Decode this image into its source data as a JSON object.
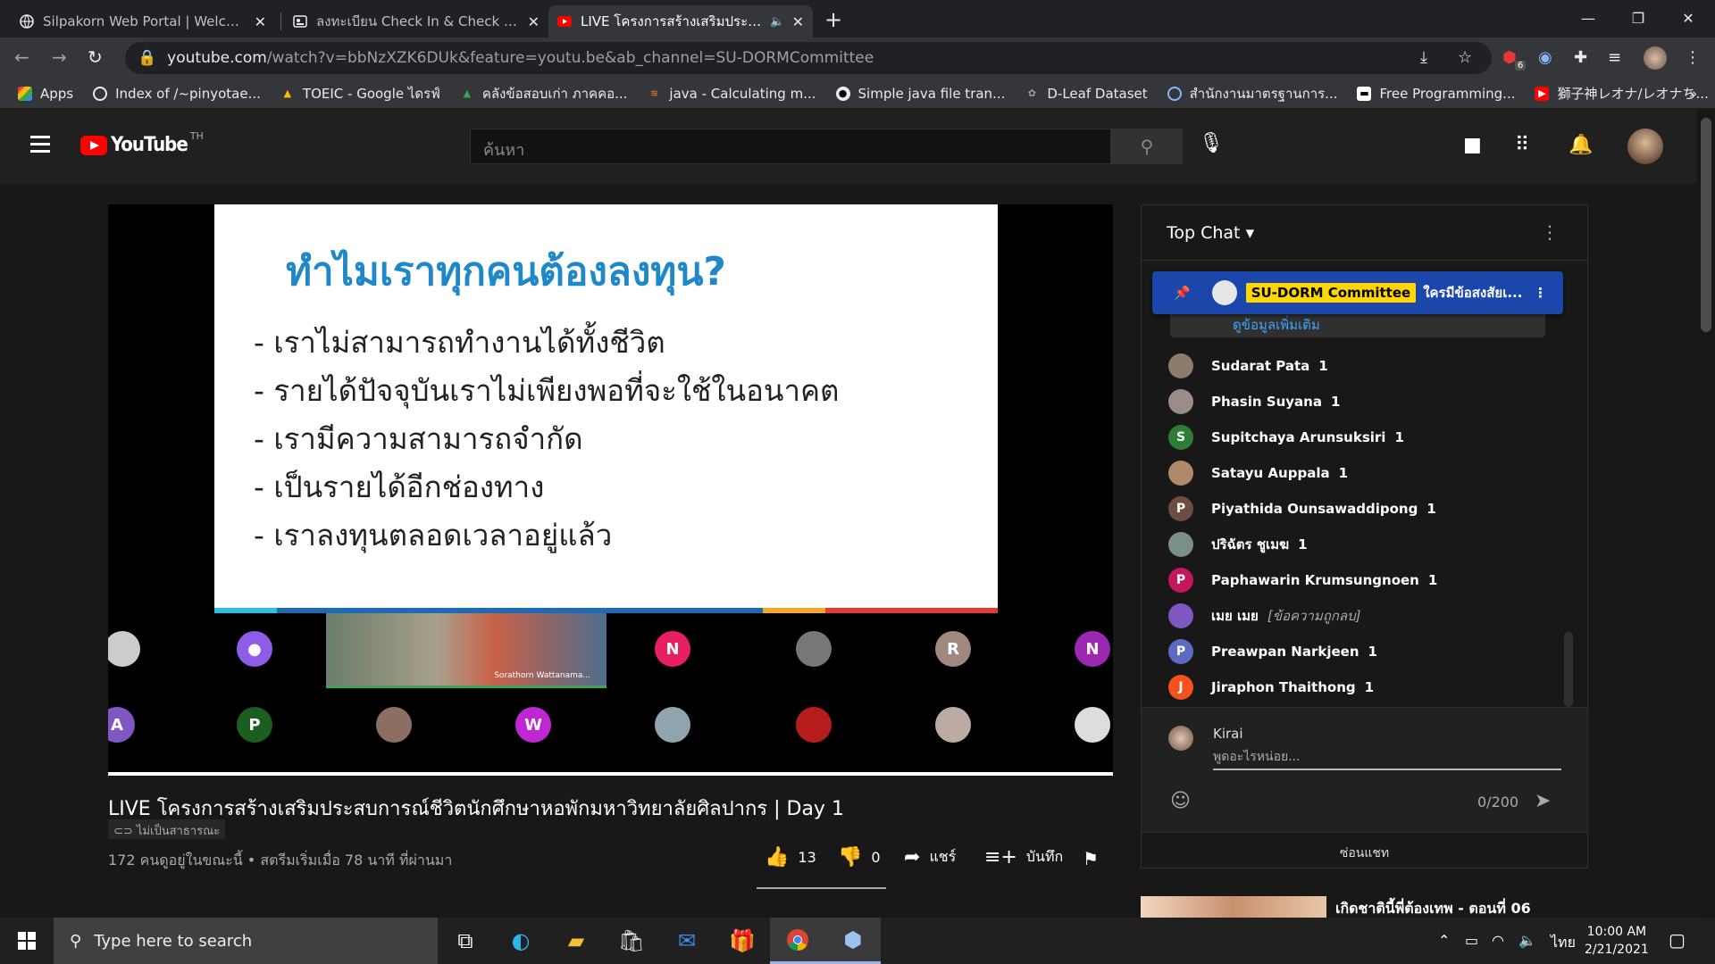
{
  "browser": {
    "tabs": [
      {
        "title": "Silpakorn Web Portal | Welcome"
      },
      {
        "title": "ลงทะเบียน Check In & Check Out ม"
      },
      {
        "title": "LIVE โครงการสร้างเสริมประสบกา"
      }
    ],
    "url_host": "youtube.com",
    "url_rest": "/watch?v=bbNzXZK6DUk&feature=youtu.be&ab_channel=SU-DORMCommittee",
    "extension_badge": "6",
    "bookmarks": [
      "Apps",
      "Index of /~pinyotae...",
      "TOEIC - Google ไดรฟ์",
      "คลังข้อสอบเก่า ภาคคอ...",
      "java - Calculating m...",
      "Simple java file tran...",
      "D-Leaf Dataset",
      "สำนักงานมาตรฐานการ...",
      "Free Programming...",
      "獅子神レオナ/レオナち..."
    ],
    "bookmarks_more": "»"
  },
  "youtube": {
    "logo_text": "YouTube",
    "region": "TH",
    "search_placeholder": "ค้นหา"
  },
  "video": {
    "slide_title": "ทำไมเราทุกคนต้องลงทุน?",
    "slide_points": [
      "- เราไม่สามารถทำงานได้ทั้งชีวิต",
      "- รายได้ปัจจุบันเราไม่เพียงพอที่จะใช้ในอนาคต",
      "- เรามีความสามารถจำกัด",
      "- เป็นรายได้อีกช่องทาง",
      "- เราลงทุนตลอดเวลาอยู่แล้ว"
    ],
    "speaker_label": "Sorathorn Wattanama...",
    "participant_initials": [
      "N",
      "R",
      "N",
      "A",
      "P",
      "W"
    ],
    "title": "LIVE โครงการสร้างเสริมประสบการณ์ชีวิตนักศึกษาหอพักมหาวิทยาลัยศิลปากร | Day 1",
    "unlisted": "ไม่เป็นสาธารณะ",
    "views": "172 คนดูอยู่ในขณะนี้ • สตรีมเริ่มเมื่อ 78 นาที ที่ผ่านมา",
    "likes": "13",
    "dislikes": "0",
    "share": "แชร์",
    "save": "บันทึก"
  },
  "chat": {
    "header": "Top Chat",
    "pinned_author": "SU-DORM Committee",
    "pinned_text": "ใครมีข้อสงสัยเ...",
    "more_info": "ดูข้อมูลเพิ่มเติม",
    "messages": [
      {
        "name": "Sudarat Pata",
        "text": "1",
        "color": "#8d7b6a",
        "initial": ""
      },
      {
        "name": "Phasin Suyana",
        "text": "1",
        "color": "#9a8c86",
        "initial": ""
      },
      {
        "name": "Supitchaya Arunsuksiri",
        "text": "1",
        "color": "#2e7d32",
        "initial": "S"
      },
      {
        "name": "Satayu Auppala",
        "text": "1",
        "color": "#b08968",
        "initial": ""
      },
      {
        "name": "Piyathida Ounsawaddipong",
        "text": "1",
        "color": "#6d4c41",
        "initial": "P"
      },
      {
        "name": "ปริฉัตร ชูเมฆ",
        "text": "1",
        "color": "#7a8f86",
        "initial": ""
      },
      {
        "name": "Paphawarin Krumsungnoen",
        "text": "1",
        "color": "#c2185b",
        "initial": "P"
      },
      {
        "name": "เมย เมย",
        "text": "[ข้อความถูกลบ]",
        "color": "#7e57c2",
        "initial": ""
      },
      {
        "name": "Preawpan Narkjeen",
        "text": "1",
        "color": "#5c6bc0",
        "initial": "P"
      },
      {
        "name": "Jiraphon Thaithong",
        "text": "1",
        "color": "#f4511e",
        "initial": "J"
      }
    ],
    "user": "Kirai",
    "input_placeholder": "พูดอะไรหน่อย...",
    "char_count": "0/200",
    "hide_chat": "ซ่อนแชท"
  },
  "recommendation": {
    "title": "เกิดชาตินี้พี่ต้องเทพ - ตอนที่ 06"
  },
  "taskbar": {
    "search_placeholder": "Type here to search",
    "language": "ไทย",
    "time": "10:00 AM",
    "date": "2/21/2021"
  }
}
